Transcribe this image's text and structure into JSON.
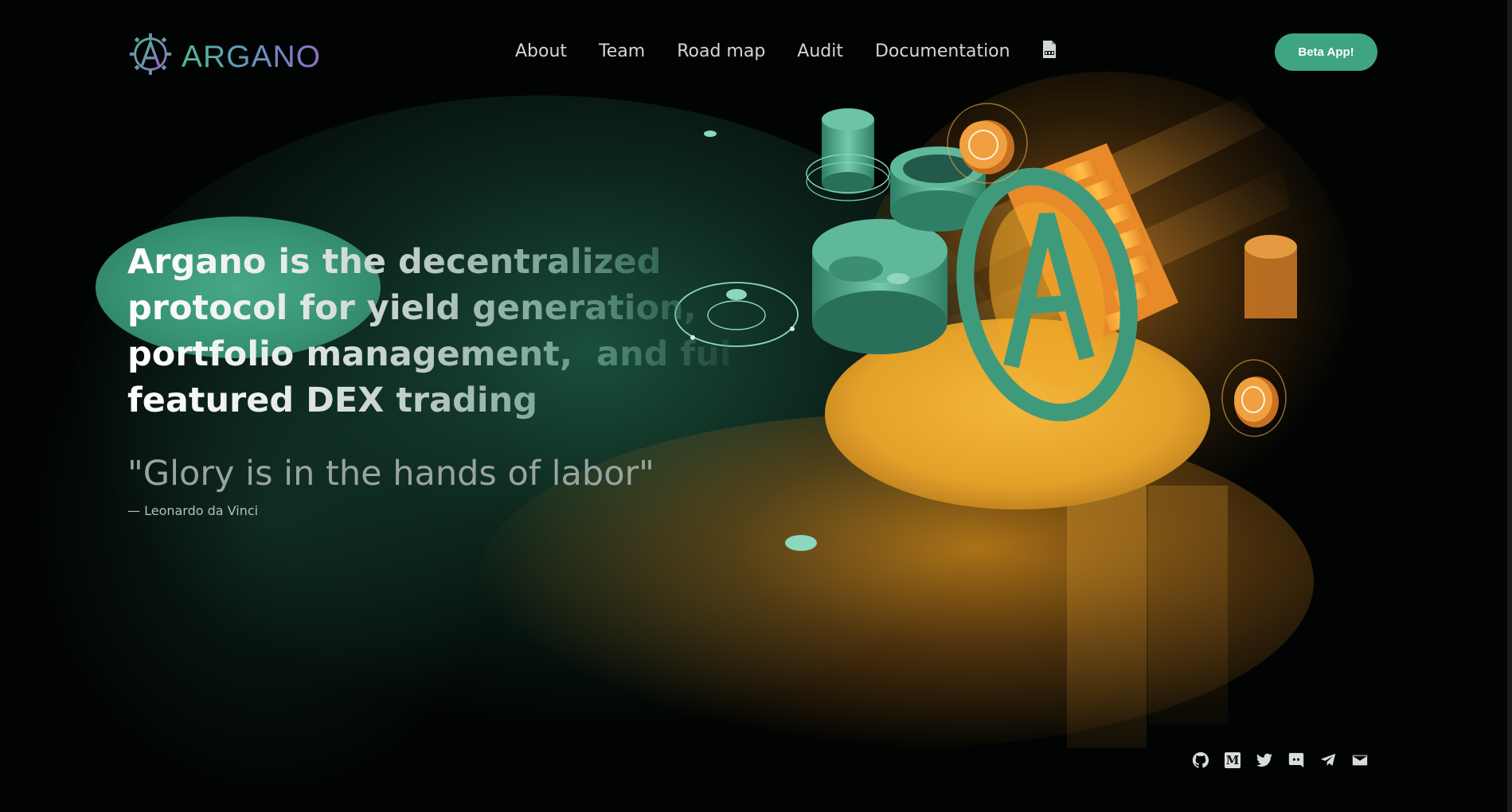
{
  "brand": {
    "name": "ARGANO",
    "logo_icon": "argano-gear-logo-icon"
  },
  "nav": {
    "items": [
      {
        "label": "About"
      },
      {
        "label": "Team"
      },
      {
        "label": "Road map"
      },
      {
        "label": "Audit"
      },
      {
        "label": "Documentation"
      }
    ],
    "pdf_icon": "pdf-document-icon"
  },
  "header": {
    "cta_label": "Beta App!"
  },
  "hero": {
    "headline_lines": [
      "Argano is the decentralized",
      "protocol for yield generation,",
      "portfolio management,  and full",
      "featured DEX trading"
    ],
    "quote": "\"Glory is in the hands of labor\"",
    "quote_author": "— Leonardo da Vinci"
  },
  "social": {
    "icons": [
      "github-icon",
      "medium-icon",
      "twitter-icon",
      "discord-icon",
      "telegram-icon",
      "email-icon"
    ]
  },
  "colors": {
    "accent": "#3fa482",
    "background": "#020403",
    "orange_glow": "#e8a028",
    "logo_gradient_start": "#4fb894",
    "logo_gradient_end": "#8b6fc2"
  }
}
